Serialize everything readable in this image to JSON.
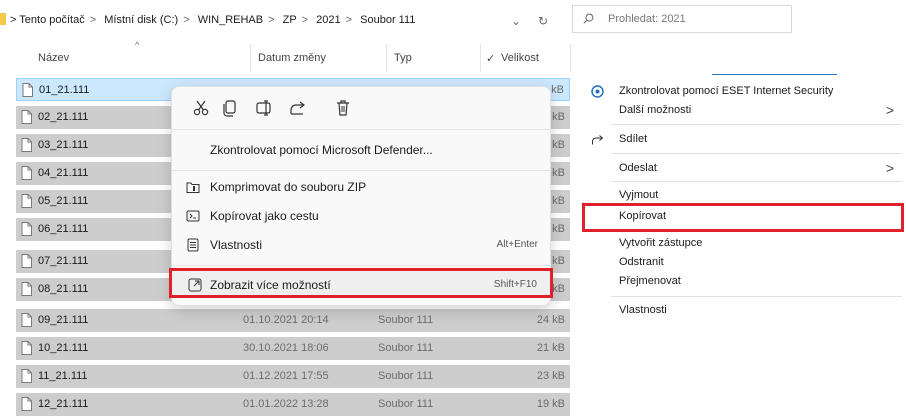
{
  "address": {
    "crumbs": [
      "Tento počítač",
      "Místní disk (C:)",
      "WIN_REHAB",
      "ZP",
      "2021",
      "Soubor 111"
    ],
    "separator": ">",
    "dropdown_glyph": "⌄",
    "refresh_glyph": "↻"
  },
  "search": {
    "placeholder": "Prohledat: 2021"
  },
  "columns": {
    "name": "Název",
    "date": "Datum změny",
    "type": "Typ",
    "size": "Velikost",
    "size_checkmark": "✓",
    "sort_indicator": "^"
  },
  "files": [
    {
      "name": "01_21.111",
      "date": "",
      "type": "",
      "size": "kB"
    },
    {
      "name": "02_21.111",
      "date": "",
      "type": "",
      "size": "kB"
    },
    {
      "name": "03_21.111",
      "date": "",
      "type": "",
      "size": "kB"
    },
    {
      "name": "04_21.111",
      "date": "",
      "type": "",
      "size": "kB"
    },
    {
      "name": "05_21.111",
      "date": "",
      "type": "",
      "size": "kB"
    },
    {
      "name": "06_21.111",
      "date": "",
      "type": "",
      "size": "kB"
    },
    {
      "name": "07_21.111",
      "date": "",
      "type": "",
      "size": "kB"
    },
    {
      "name": "08_21.111",
      "date": "",
      "type": "",
      "size": "kB"
    },
    {
      "name": "09_21.111",
      "date": "01.10.2021 20:14",
      "type": "Soubor 111",
      "size": "24 kB"
    },
    {
      "name": "10_21.111",
      "date": "30.10.2021 18:06",
      "type": "Soubor 111",
      "size": "21 kB"
    },
    {
      "name": "11_21.111",
      "date": "01.12.2021 17:55",
      "type": "Soubor 111",
      "size": "23 kB"
    },
    {
      "name": "12_21.111",
      "date": "01.01.2022 13:28",
      "type": "Soubor 111",
      "size": "19 kB"
    }
  ],
  "context_menu": {
    "quick_actions": [
      "cut-icon",
      "copy-icon",
      "rename-icon",
      "share-icon",
      "delete-icon"
    ],
    "defender": "Zkontrolovat pomocí Microsoft Defender...",
    "zip": "Komprimovat do souboru ZIP",
    "copy_path": "Kopírovat jako cestu",
    "properties": "Vlastnosti",
    "properties_shortcut": "Alt+Enter",
    "more_options": "Zobrazit více možností",
    "more_options_shortcut": "Shift+F10"
  },
  "classic_menu": {
    "eset": "Zkontrolovat pomocí ESET Internet Security",
    "more": "Další možnosti",
    "share": "Sdílet",
    "send_to": "Odeslat",
    "cut": "Vyjmout",
    "copy": "Kopírovat",
    "shortcut": "Vytvořit zástupce",
    "delete": "Odstranit",
    "rename": "Přejmenovat",
    "properties": "Vlastnosti",
    "submenu_arrow": ">"
  },
  "colors": {
    "highlight_red": "#e0202a",
    "selection": "#cce8ff",
    "row_grey": "#cdcdcd"
  }
}
